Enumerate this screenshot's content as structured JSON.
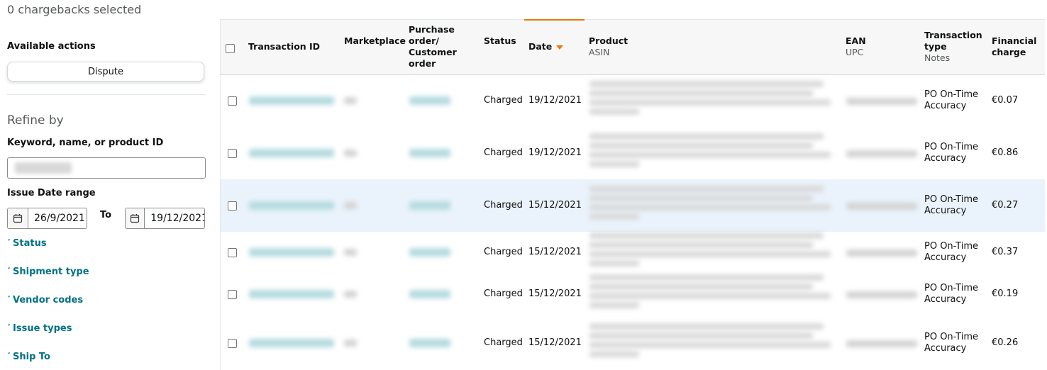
{
  "header": {
    "selected_count": "0 chargebacks selected"
  },
  "sidebar": {
    "available_actions_label": "Available actions",
    "dispute_button": "Dispute",
    "refine_label": "Refine by",
    "keyword_label": "Keyword, name, or product ID",
    "issue_date_label": "Issue Date range",
    "date_from": "26/9/2021",
    "to_label": "To",
    "date_to": "19/12/2021",
    "filters": [
      {
        "label": "Status"
      },
      {
        "label": "Shipment type"
      },
      {
        "label": "Vendor codes"
      },
      {
        "label": "Issue types"
      },
      {
        "label": "Ship To"
      }
    ]
  },
  "table": {
    "columns": {
      "transaction_id": "Transaction ID",
      "marketplace": "Marketplace",
      "po_line1": "Purchase",
      "po_line2": "order/",
      "po_line3": "Customer",
      "po_line4": "order",
      "status": "Status",
      "date": "Date",
      "product": "Product",
      "product_sub": "ASIN",
      "ean": "EAN",
      "ean_sub": "UPC",
      "type_line1": "Transaction",
      "type_line2": "type",
      "type_sub": "Notes",
      "charge_line1": "Financial",
      "charge_line2": "charge"
    },
    "sort": {
      "column": "date",
      "direction": "descending"
    },
    "rows": [
      {
        "status": "Charged",
        "date": "19/12/2021",
        "type_line1": "PO On-Time",
        "type_line2": "Accuracy",
        "charge": "€0.07"
      },
      {
        "status": "Charged",
        "date": "19/12/2021",
        "type_line1": "PO On-Time",
        "type_line2": "Accuracy",
        "charge": "€0.86"
      },
      {
        "status": "Charged",
        "date": "15/12/2021",
        "type_line1": "PO On-Time",
        "type_line2": "Accuracy",
        "charge": "€0.27"
      },
      {
        "status": "Charged",
        "date": "15/12/2021",
        "type_line1": "PO On-Time",
        "type_line2": "Accuracy",
        "charge": "€0.37"
      },
      {
        "status": "Charged",
        "date": "15/12/2021",
        "type_line1": "PO On-Time",
        "type_line2": "Accuracy",
        "charge": "€0.19"
      },
      {
        "status": "Charged",
        "date": "15/12/2021",
        "type_line1": "PO On-Time",
        "type_line2": "Accuracy",
        "charge": "€0.26"
      }
    ],
    "highlighted_row": 2
  },
  "icons": {
    "calendar": "calendar-icon",
    "chevron": "chevron-down-icon",
    "sort": "sort-descending-icon"
  },
  "colors": {
    "link": "#007185",
    "accent": "#e47911",
    "row_highlight": "#eaf3fb"
  }
}
